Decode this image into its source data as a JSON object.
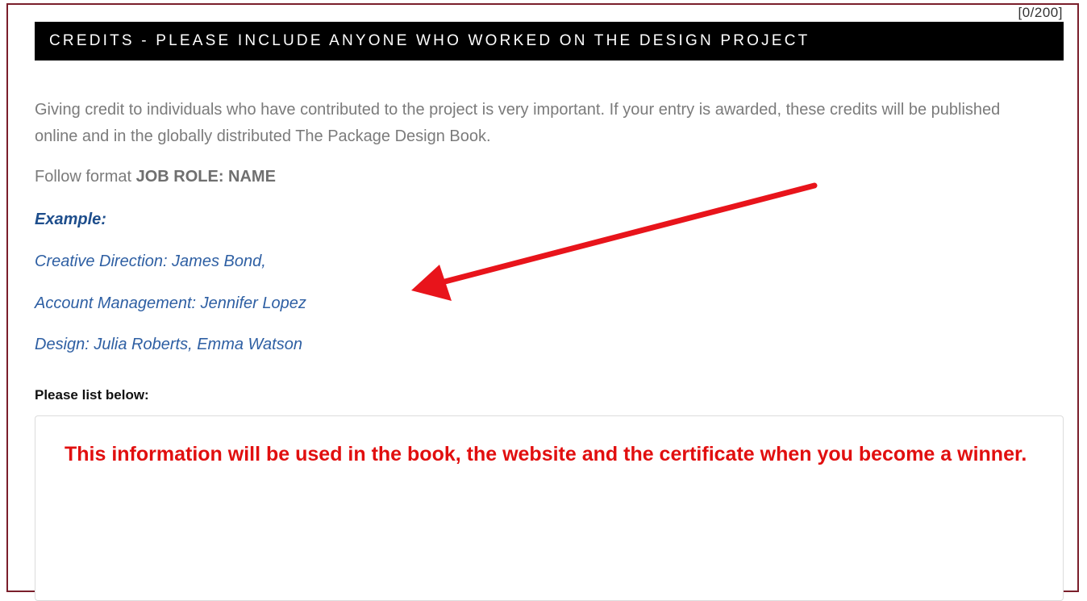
{
  "counter": "[0/200]",
  "section_header": "CREDITS - PLEASE INCLUDE ANYONE WHO WORKED ON THE DESIGN PROJECT",
  "intro_text": "Giving credit to individuals who have contributed to the project is very important. If your entry is awarded, these credits will be published online and in the globally distributed The Package Design Book.",
  "format": {
    "prefix": "Follow format ",
    "value": "JOB ROLE: NAME"
  },
  "example": {
    "heading": "Example:",
    "lines": [
      "Creative Direction: James Bond,",
      "Account Management: Jennifer Lopez",
      "Design: Julia Roberts, Emma Watson"
    ]
  },
  "list_label": "Please list below:",
  "annotation_notice": "This information will be used in the book, the website and the certificate when you become a winner.",
  "colors": {
    "header_bg": "#000000",
    "example_blue": "#2e5fa3",
    "notice_red": "#e10f0f",
    "arrow_red": "#e8141b",
    "frame_border": "#7a1f2b"
  },
  "icons": [
    "red-annotation-arrow"
  ]
}
